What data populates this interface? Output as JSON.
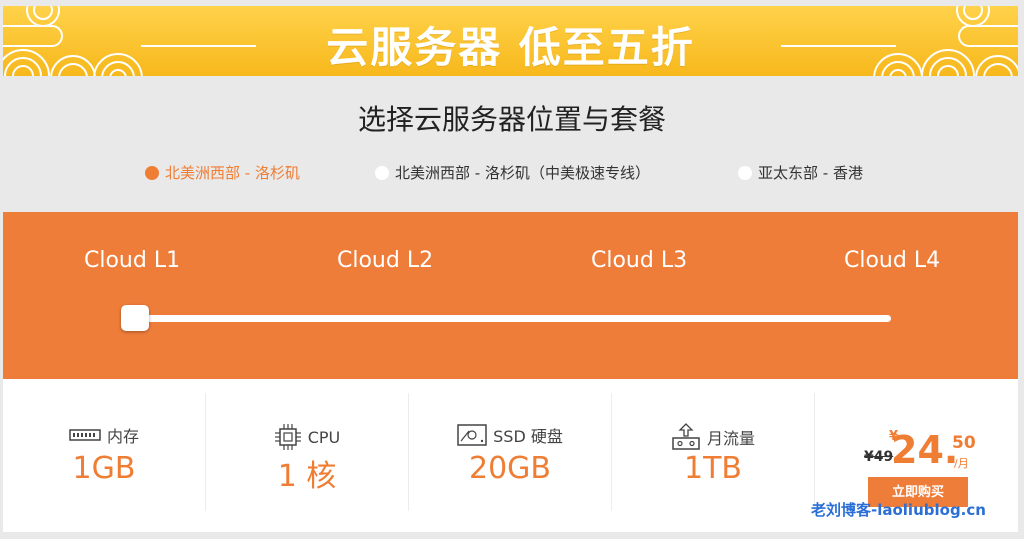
{
  "banner": {
    "title": "云服务器 低至五折"
  },
  "heading": "选择云服务器位置与套餐",
  "regions": [
    {
      "label": "北美洲西部 - 洛杉矶",
      "active": true
    },
    {
      "label": "北美洲西部 - 洛杉矶（中美极速专线）",
      "active": false
    },
    {
      "label": "亚太东部 - 香港",
      "active": false
    }
  ],
  "plans": [
    "Cloud L1",
    "Cloud L2",
    "Cloud L3",
    "Cloud L4"
  ],
  "slider": {
    "selected_plan": "Cloud L1"
  },
  "specs": [
    {
      "label": "内存",
      "value": "1GB",
      "icon": "memory-icon"
    },
    {
      "label": "CPU",
      "value": "1 核",
      "icon": "cpu-icon"
    },
    {
      "label": "SSD 硬盘",
      "value": "20GB",
      "icon": "ssd-icon"
    },
    {
      "label": "月流量",
      "value": "1TB",
      "icon": "traffic-icon"
    }
  ],
  "price": {
    "old": "¥49",
    "currency": "¥",
    "integer": "24.",
    "decimal": "50",
    "per": "/月",
    "buy_label": "立即购买"
  },
  "watermark": "老刘博客-laoliublog.cn",
  "colors": {
    "accent": "#ef7d3a",
    "banner": "#f7b81c",
    "watermark": "#2b6fd6"
  }
}
